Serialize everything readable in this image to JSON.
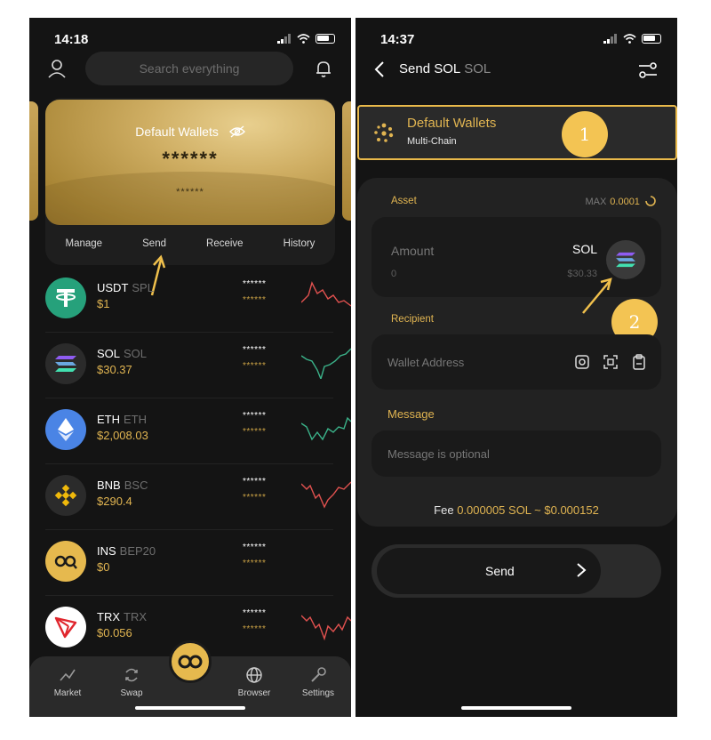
{
  "left": {
    "time": "14:18",
    "search_placeholder": "Search everything",
    "card": {
      "title": "Default Wallets",
      "balance_hidden": "******",
      "sub_hidden": "******"
    },
    "actions": [
      "Manage",
      "Send",
      "Receive",
      "History"
    ],
    "tokens": [
      {
        "symbol": "USDT",
        "chain": "SPL",
        "price": "$1",
        "hidden1": "******",
        "hidden2": "******",
        "logo_color": "#26a17b",
        "trend": "down"
      },
      {
        "symbol": "SOL",
        "chain": "SOL",
        "price": "$30.37",
        "hidden1": "******",
        "hidden2": "******",
        "logo_color": "#2b2b2b",
        "trend": "up"
      },
      {
        "symbol": "ETH",
        "chain": "ETH",
        "price": "$2,008.03",
        "hidden1": "******",
        "hidden2": "******",
        "logo_color": "#4a84e5",
        "trend": "up"
      },
      {
        "symbol": "BNB",
        "chain": "BSC",
        "price": "$290.4",
        "hidden1": "******",
        "hidden2": "******",
        "logo_color": "#2b2b2b",
        "trend": "down"
      },
      {
        "symbol": "INS",
        "chain": "BEP20",
        "price": "$0",
        "hidden1": "******",
        "hidden2": "******",
        "logo_color": "#e6b94e",
        "trend": "none"
      },
      {
        "symbol": "TRX",
        "chain": "TRX",
        "price": "$0.056",
        "hidden1": "******",
        "hidden2": "******",
        "logo_color": "#ffffff",
        "trend": "down"
      }
    ],
    "nav": [
      "Market",
      "Swap",
      "Browser",
      "Settings"
    ]
  },
  "right": {
    "time": "14:37",
    "header_title": "Send SOL",
    "header_sub": "SOL",
    "wallet_name": "Default Wallets",
    "wallet_type": "Multi-Chain",
    "badge1": "1",
    "badge2": "2",
    "asset_label": "Asset",
    "max_label": "MAX",
    "max_value": "0.0001",
    "amount_placeholder": "Amount",
    "amount_zero": "0",
    "amount_symbol": "SOL",
    "amount_usd": "$30.33",
    "recipient_label": "Recipient",
    "wallet_address_placeholder": "Wallet Address",
    "message_label": "Message",
    "message_placeholder": "Message is optional",
    "fee_prefix": "Fee",
    "fee_value": "0.000005 SOL ~ $0.000152",
    "send_label": "Send"
  },
  "colors": {
    "accent_gold": "#e0b451",
    "background": "#141414",
    "panel": "#222222",
    "highlight_border": "#e9b94a",
    "spark_red": "#e0514f",
    "spark_green": "#3bb38a"
  }
}
